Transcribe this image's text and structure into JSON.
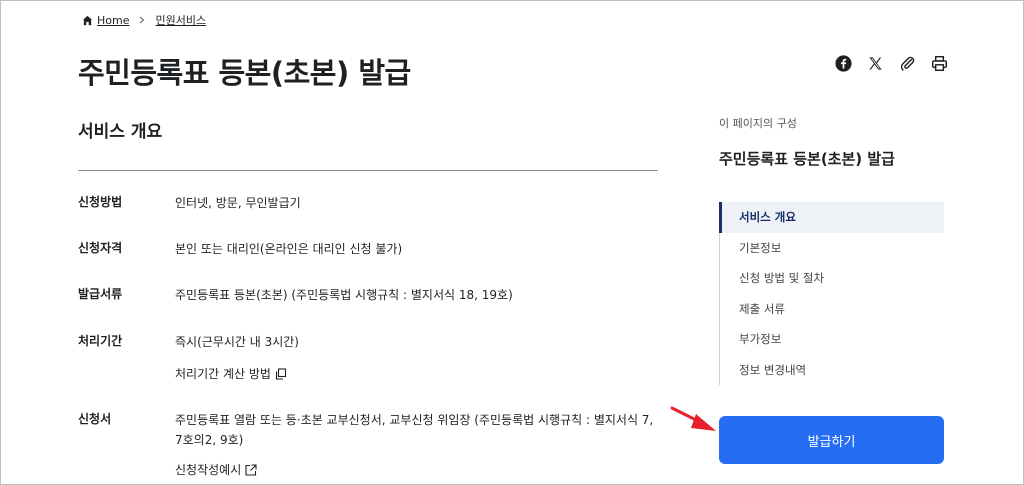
{
  "breadcrumb": {
    "home": "Home",
    "current": "민원서비스"
  },
  "page": {
    "title": "주민등록표 등본(초본) 발급"
  },
  "share": {
    "icons": [
      "facebook-icon",
      "x-icon",
      "attachment-icon",
      "print-icon"
    ]
  },
  "overview": {
    "title": "서비스 개요",
    "rows": [
      {
        "label": "신청방법",
        "lines": [
          "인터넷, 방문, 무인발급기"
        ]
      },
      {
        "label": "신청자격",
        "lines": [
          "본인 또는 대리인(온라인은 대리인 신청 불가)"
        ]
      },
      {
        "label": "발급서류",
        "lines": [
          "주민등록표 등본(초본) (주민등록법 시행규칙 : 별지서식 18, 19호)"
        ]
      },
      {
        "label": "처리기간",
        "lines": [
          "즉시(근무시간 내 3시간)"
        ],
        "link": "처리기간 계산 방법"
      },
      {
        "label": "신청서",
        "lines": [
          "주민등록표 열람 또는 등·초본 교부신청서, 교부신청 위임장 (주민등록법 시행규칙 : 별지서식 7,",
          "7호의2, 9호)"
        ],
        "link": "신청작성예시"
      }
    ]
  },
  "toc": {
    "caption": "이 페이지의 구성",
    "title": "주민등록표 등본(초본) 발급",
    "items": [
      "서비스 개요",
      "기본정보",
      "신청 방법 및 절차",
      "제출 서류",
      "부가정보",
      "정보 변경내역"
    ],
    "active_index": 0
  },
  "actions": {
    "issue_label": "발급하기"
  },
  "colors": {
    "primary": "#256ef4",
    "toc_active": "#1a2d6b",
    "annotation_arrow": "#e8202a"
  }
}
